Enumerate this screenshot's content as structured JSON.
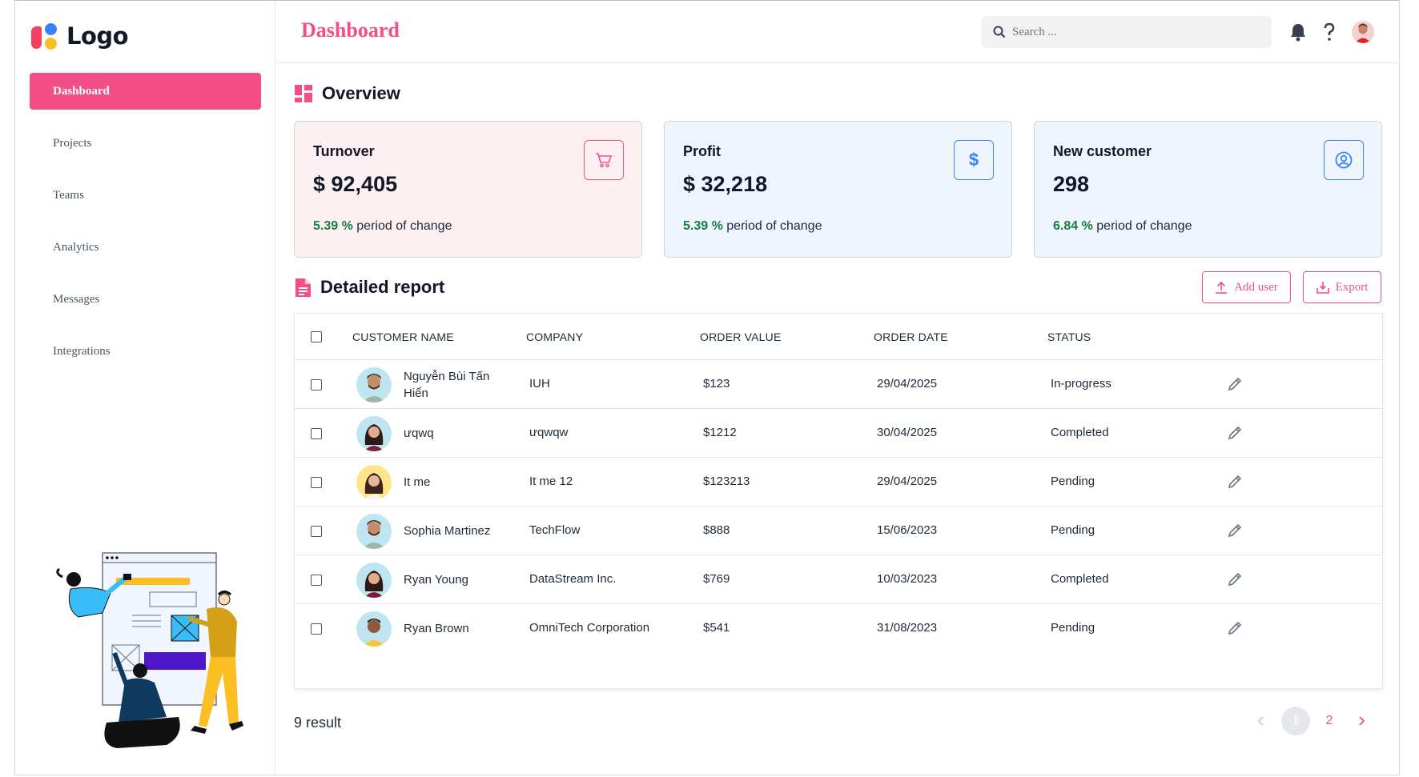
{
  "app": {
    "logo_text": "Logo",
    "page_title": "Dashboard"
  },
  "sidebar": {
    "items": [
      {
        "label": "Dashboard",
        "active": true
      },
      {
        "label": "Projects",
        "active": false
      },
      {
        "label": "Teams",
        "active": false
      },
      {
        "label": "Analytics",
        "active": false
      },
      {
        "label": "Messages",
        "active": false
      },
      {
        "label": "Integrations",
        "active": false
      }
    ]
  },
  "header": {
    "search_placeholder": "Search ...",
    "icons": [
      "bell-icon",
      "help-icon",
      "user-avatar"
    ]
  },
  "overview": {
    "title": "Overview",
    "cards": [
      {
        "label": "Turnover",
        "value": "$ 92,405",
        "change": "5.39 %",
        "change_text": "period of change",
        "icon": "cart-icon",
        "bg": "#fdf0f3",
        "accent": "#f44e86"
      },
      {
        "label": "Profit",
        "value": "$ 32,218",
        "change": "5.39 %",
        "change_text": "period of change",
        "icon": "dollar-icon",
        "bg": "#eef5fe",
        "accent": "#3b82f6"
      },
      {
        "label": "New customer",
        "value": "298",
        "change": "6.84 %",
        "change_text": "period of change",
        "icon": "user-circle-icon",
        "bg": "#eef5fe",
        "accent": "#3b82f6"
      }
    ]
  },
  "report": {
    "title": "Detailed report",
    "add_user_label": "Add user",
    "export_label": "Export",
    "columns": [
      "CUSTOMER NAME",
      "COMPANY",
      "ORDER VALUE",
      "ORDER DATE",
      "STATUS"
    ],
    "rows": [
      {
        "name": "Nguyễn Bùi Tấn Hiển",
        "company": "IUH",
        "value": "$123",
        "date": "29/04/2025",
        "status": "In-progress",
        "avatar": "man-beard"
      },
      {
        "name": "ưqwq",
        "company": "ưqwqw",
        "value": "$1212",
        "date": "30/04/2025",
        "status": "Completed",
        "avatar": "woman-dark"
      },
      {
        "name": "It me",
        "company": "It me 12",
        "value": "$123213",
        "date": "29/04/2025",
        "status": "Pending",
        "avatar": "woman-yellow"
      },
      {
        "name": "Sophia Martinez",
        "company": "TechFlow",
        "value": "$888",
        "date": "15/06/2023",
        "status": "Pending",
        "avatar": "man-beard"
      },
      {
        "name": "Ryan Young",
        "company": "DataStream Inc.",
        "value": "$769",
        "date": "10/03/2023",
        "status": "Completed",
        "avatar": "woman-dark"
      },
      {
        "name": "Ryan Brown",
        "company": "OmniTech Corporation",
        "value": "$541",
        "date": "31/08/2023",
        "status": "Pending",
        "avatar": "man-smile"
      }
    ],
    "result_text": "9 result",
    "pages": [
      "1",
      "2"
    ],
    "current_page": "1"
  },
  "colors": {
    "accent": "#f44e86",
    "green": "#15803d",
    "blue": "#3b82f6"
  }
}
